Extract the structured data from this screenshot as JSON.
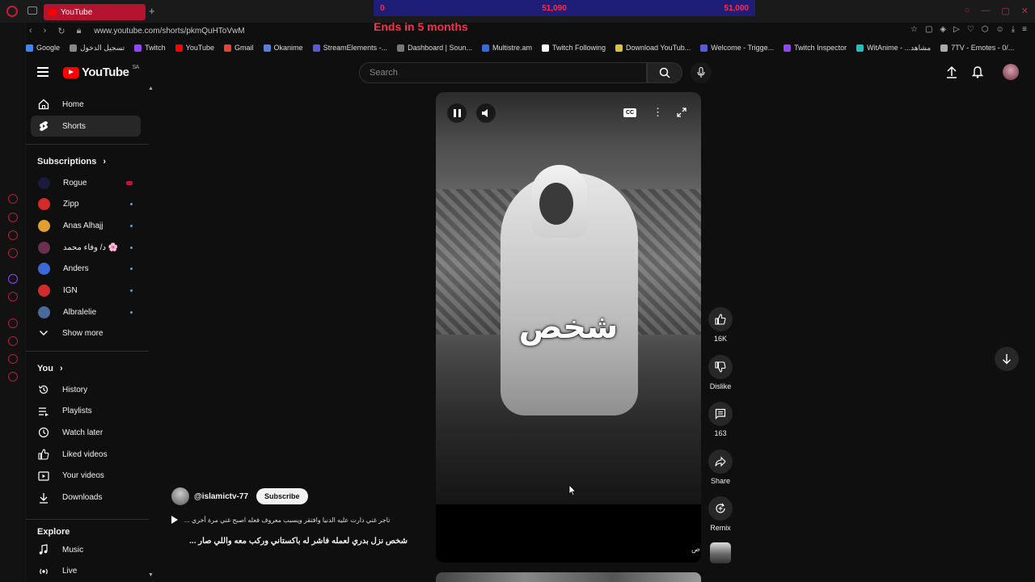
{
  "browser": {
    "tab_title": "YouTube",
    "url": "www.youtube.com/shorts/pkmQuHToVwM",
    "overlay": {
      "goal_left": "0",
      "goal_mid": "51,090",
      "goal_right": "51,000",
      "ends_text": "Ends in 5 months"
    },
    "bookmarks": [
      {
        "label": "Google",
        "color": "#4285f4"
      },
      {
        "label": "تسجيل الدخول",
        "color": "#888888"
      },
      {
        "label": "Twitch",
        "color": "#9146ff"
      },
      {
        "label": "YouTube",
        "color": "#ff0000"
      },
      {
        "label": "Gmail",
        "color": "#ea4335"
      },
      {
        "label": "Okanime",
        "color": "#5a7fd6"
      },
      {
        "label": "StreamElements -...",
        "color": "#5a5ad6"
      },
      {
        "label": "Dashboard | Soun...",
        "color": "#777777"
      },
      {
        "label": "Multistre.am",
        "color": "#3a6ad6"
      },
      {
        "label": "Twitch Following",
        "color": "#ffffff"
      },
      {
        "label": "Download YouTub...",
        "color": "#e0c040"
      },
      {
        "label": "Welcome - Trigge...",
        "color": "#5a5ad6"
      },
      {
        "label": "Twitch Inspector",
        "color": "#9146ff"
      },
      {
        "label": "WitAnime - ...مشاهد",
        "color": "#20c0c0"
      },
      {
        "label": "7TV - Emotes - 0/...",
        "color": "#aaaaaa"
      }
    ]
  },
  "header": {
    "logo_text": "YouTube",
    "country_code": "SA",
    "search_placeholder": "Search"
  },
  "sidebar": {
    "main": [
      {
        "label": "Home",
        "icon": "home-icon"
      },
      {
        "label": "Shorts",
        "icon": "shorts-icon"
      }
    ],
    "subscriptions_heading": "Subscriptions",
    "subscriptions": [
      {
        "label": "Rogue",
        "color": "#1a1a3a",
        "live": true
      },
      {
        "label": "Zipp",
        "color": "#d62a2a",
        "live": false
      },
      {
        "label": "Anas Alhajj",
        "color": "#e0a030",
        "live": false
      },
      {
        "label": "د/ وفاء محمد 🌸",
        "color": "#6a3050",
        "live": false
      },
      {
        "label": "Anders",
        "color": "#3a6ad6",
        "live": false
      },
      {
        "label": "IGN",
        "color": "#d62a2a",
        "live": false
      },
      {
        "label": "Albralelie",
        "color": "#4a6a9a",
        "live": false
      }
    ],
    "show_more": "Show more",
    "you_heading": "You",
    "you_items": [
      {
        "label": "History",
        "icon": "history-icon"
      },
      {
        "label": "Playlists",
        "icon": "playlists-icon"
      },
      {
        "label": "Watch later",
        "icon": "clock-icon"
      },
      {
        "label": "Liked videos",
        "icon": "thumb-up-icon"
      },
      {
        "label": "Your videos",
        "icon": "video-icon"
      },
      {
        "label": "Downloads",
        "icon": "download-icon"
      }
    ],
    "explore_heading": "Explore",
    "explore_items": [
      {
        "label": "Music",
        "icon": "music-icon"
      },
      {
        "label": "Live",
        "icon": "live-icon"
      }
    ]
  },
  "short": {
    "caption_word": "شخص",
    "bottom_arabic": "ص",
    "channel_handle": "@islamictv-77",
    "subscribe_label": "Subscribe",
    "music_text": "... تاجر غني دارت عليه الدنيا وافتقر ويسبب معروف فعله اصبح غني مرة أخري",
    "title": "شخص نزل بدري لعمله فاشر له باكستاني وركب معه واللي صار ..."
  },
  "actions": {
    "like_count": "16K",
    "dislike_label": "Dislike",
    "comment_count": "163",
    "share_label": "Share",
    "remix_label": "Remix"
  }
}
